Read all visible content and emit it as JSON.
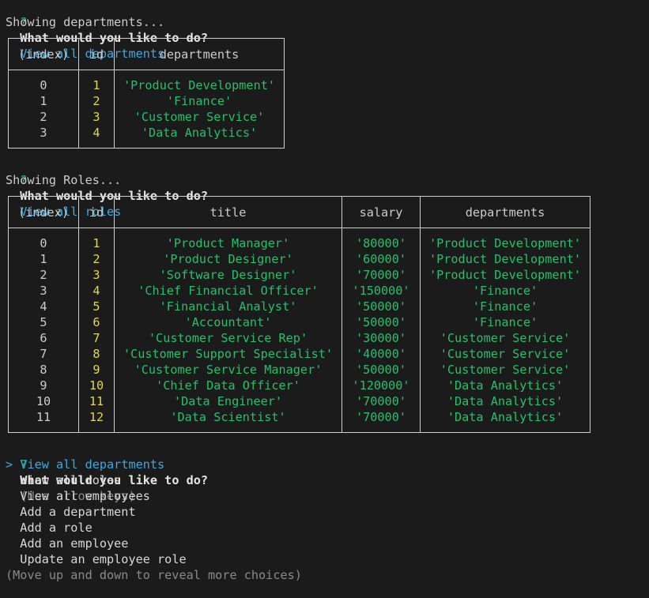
{
  "prompt1": {
    "marker": "?",
    "question": "What would you like to do?",
    "answer": "View all departments",
    "status": "Showing departments..."
  },
  "departments_table": {
    "headers": [
      "(index)",
      "id",
      "departments"
    ],
    "rows": [
      {
        "index": "0",
        "id": "1",
        "name": "'Product Development'"
      },
      {
        "index": "1",
        "id": "2",
        "name": "'Finance'"
      },
      {
        "index": "2",
        "id": "3",
        "name": "'Customer Service'"
      },
      {
        "index": "3",
        "id": "4",
        "name": "'Data Analytics'"
      }
    ]
  },
  "prompt2": {
    "marker": "?",
    "question": "What would you like to do?",
    "answer": "View all roles",
    "status": "Showing Roles..."
  },
  "roles_table": {
    "headers": [
      "(index)",
      "id",
      "title",
      "salary",
      "departments"
    ],
    "rows": [
      {
        "index": "0",
        "id": "1",
        "title": "'Product Manager'",
        "salary": "'80000'",
        "dept": "'Product Development'"
      },
      {
        "index": "1",
        "id": "2",
        "title": "'Product Designer'",
        "salary": "'60000'",
        "dept": "'Product Development'"
      },
      {
        "index": "2",
        "id": "3",
        "title": "'Software Designer'",
        "salary": "'70000'",
        "dept": "'Product Development'"
      },
      {
        "index": "3",
        "id": "4",
        "title": "'Chief Financial Officer'",
        "salary": "'150000'",
        "dept": "'Finance'"
      },
      {
        "index": "4",
        "id": "5",
        "title": "'Financial Analyst'",
        "salary": "'50000'",
        "dept": "'Finance'"
      },
      {
        "index": "5",
        "id": "6",
        "title": "'Accountant'",
        "salary": "'50000'",
        "dept": "'Finance'"
      },
      {
        "index": "6",
        "id": "7",
        "title": "'Customer Service Rep'",
        "salary": "'30000'",
        "dept": "'Customer Service'"
      },
      {
        "index": "7",
        "id": "8",
        "title": "'Customer Support Specialist'",
        "salary": "'40000'",
        "dept": "'Customer Service'"
      },
      {
        "index": "8",
        "id": "9",
        "title": "'Customer Service Manager'",
        "salary": "'50000'",
        "dept": "'Customer Service'"
      },
      {
        "index": "9",
        "id": "10",
        "title": "'Chief Data Officer'",
        "salary": "'120000'",
        "dept": "'Data Analytics'"
      },
      {
        "index": "10",
        "id": "11",
        "title": "'Data Engineer'",
        "salary": "'70000'",
        "dept": "'Data Analytics'"
      },
      {
        "index": "11",
        "id": "12",
        "title": "'Data Scientist'",
        "salary": "'70000'",
        "dept": "'Data Analytics'"
      }
    ]
  },
  "prompt3": {
    "marker": "?",
    "question": "What would you like to do?",
    "hint": "(Use arrow keys)",
    "pointer": ">",
    "choices": [
      "View all departments",
      "View all roles",
      "View all employees",
      "Add a department",
      "Add a role",
      "Add an employee",
      "Update an employee role"
    ],
    "selected_index": 0,
    "footer": "(Move up and down to reveal more choices)"
  },
  "colors": {
    "background": "#1b1b1b",
    "prompt_marker": "#2fbf71",
    "answer": "#3ea8e0",
    "string_value": "#23c26a",
    "number_value": "#e8d44d",
    "dim_text": "#8a8a8a"
  }
}
